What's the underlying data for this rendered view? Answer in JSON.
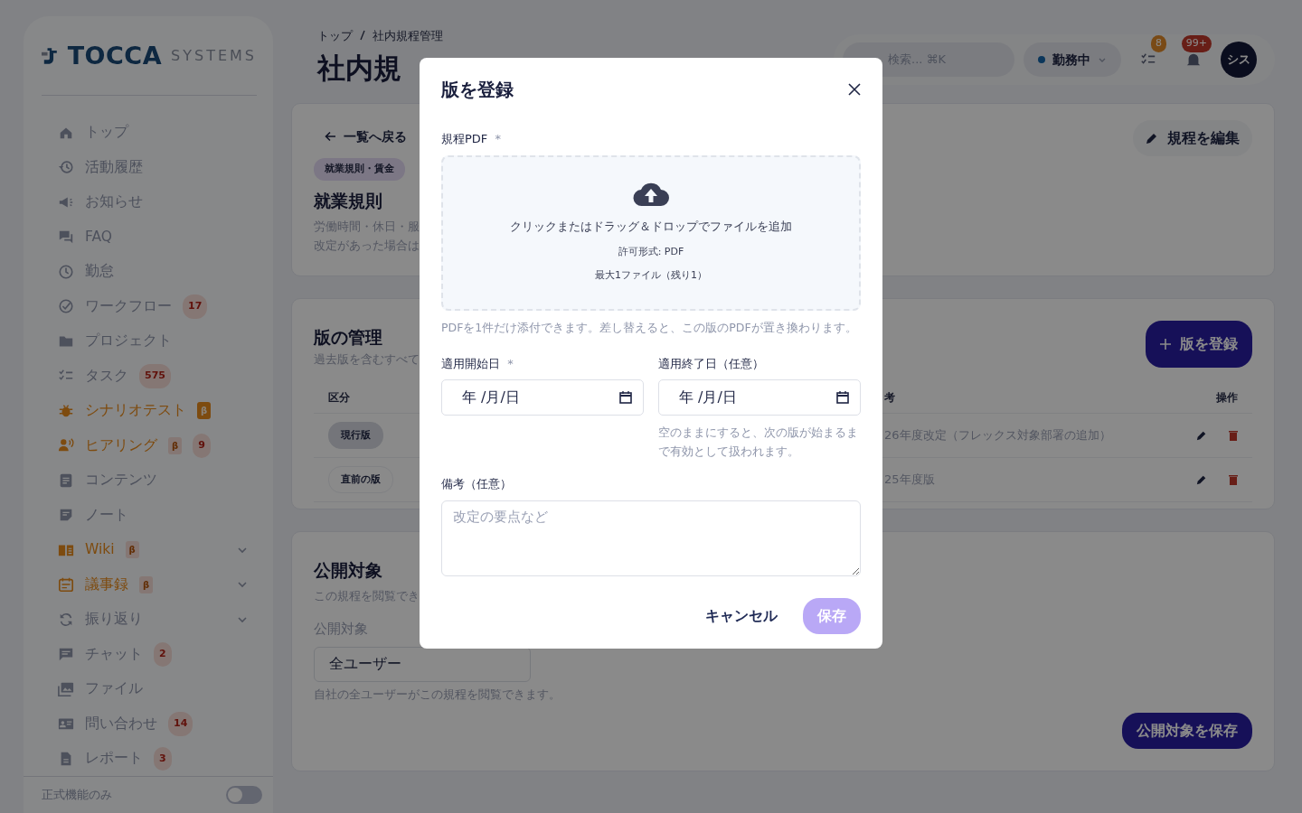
{
  "sidebar": {
    "logo": {
      "brand": "TOCCA",
      "suffix": "SYSTEMS"
    },
    "items": [
      {
        "label": "トップ",
        "highlighted": false
      },
      {
        "label": "活動履歴",
        "highlighted": false
      },
      {
        "label": "お知らせ",
        "highlighted": false
      },
      {
        "label": "FAQ",
        "highlighted": false
      },
      {
        "label": "勤怠",
        "highlighted": false
      },
      {
        "label": "ワークフロー",
        "highlighted": false,
        "badge": "17"
      },
      {
        "label": "プロジェクト",
        "highlighted": false
      },
      {
        "label": "タスク",
        "highlighted": false,
        "badge": "575"
      },
      {
        "label": "シナリオテスト",
        "highlighted": true,
        "tag": "β",
        "tag_solid": true
      },
      {
        "label": "ヒアリング",
        "highlighted": true,
        "tag": "β",
        "tag_solid": false,
        "badge": "9"
      },
      {
        "label": "コンテンツ",
        "highlighted": false
      },
      {
        "label": "ノート",
        "highlighted": false
      },
      {
        "label": "Wiki",
        "highlighted": true,
        "tag": "β",
        "tag_solid": false,
        "expanded": false
      },
      {
        "label": "議事録",
        "highlighted": true,
        "tag": "β",
        "tag_solid": false,
        "expanded": false
      },
      {
        "label": "振り返り",
        "highlighted": false,
        "expanded": false
      },
      {
        "label": "チャット",
        "highlighted": false,
        "badge": "2"
      },
      {
        "label": "ファイル",
        "highlighted": false
      },
      {
        "label": "問い合わせ",
        "highlighted": false,
        "badge": "14"
      },
      {
        "label": "レポート",
        "highlighted": false,
        "badge": "3"
      }
    ],
    "footer_toggle": {
      "label": "正式機能のみ",
      "on": false
    }
  },
  "header": {
    "breadcrumb": [
      "トップ",
      "社内規程管理"
    ],
    "title": "社内規",
    "search": {
      "placeholder": "検索... ⌘K"
    },
    "status": {
      "label": "勤務中"
    },
    "task_badge": "8",
    "notification_badge": "99+",
    "avatar": "シス"
  },
  "rule_card": {
    "back_link": "一覧へ戻る",
    "tag": "就業規則・賃金",
    "title": "就業規則",
    "description_lines": [
      "労働時間・休日・服",
      "改定があった場合は"
    ],
    "edit_button": "規程を編集"
  },
  "versions_card": {
    "title": "版の管理",
    "subtitle": "過去版を含むすべて",
    "add_button": "版を登録",
    "columns": [
      "区分",
      "考",
      "操作"
    ],
    "rows": [
      {
        "category": "現行版",
        "current": true,
        "note": "26年度改定（フレックス対象部署の追加）"
      },
      {
        "category": "直前の版",
        "current": false,
        "note": "25年度版"
      }
    ]
  },
  "audience_card": {
    "title": "公開対象",
    "subtitle": "この規程を閲覧でき",
    "field_label": "公開対象",
    "value": "全ユーザー",
    "help": "自社の全ユーザーがこの規程を閲覧できます。",
    "save_button": "公開対象を保存"
  },
  "modal": {
    "title": "版を登録",
    "pdf_label": "規程PDF",
    "pdf_required_mark": "*",
    "dropzone": {
      "prompt": "クリックまたはドラッグ＆ドロップでファイルを追加",
      "formats": "許可形式: PDF",
      "limit": "最大1ファイル（残り1）"
    },
    "pdf_help": "PDFを1件だけ添付できます。差し替えると、この版のPDFが置き換わります。",
    "start_date": {
      "label": "適用開始日",
      "required_mark": "*",
      "value": "年 /月/日"
    },
    "end_date": {
      "label": "適用終了日（任意）",
      "value": "年 /月/日",
      "help": "空のままにすると、次の版が始まるまで有効として扱われます。"
    },
    "note": {
      "label": "備考（任意）",
      "placeholder": "改定の要点など"
    },
    "cancel_button": "キャンセル",
    "save_button": {
      "label": "保存",
      "disabled": true
    }
  }
}
